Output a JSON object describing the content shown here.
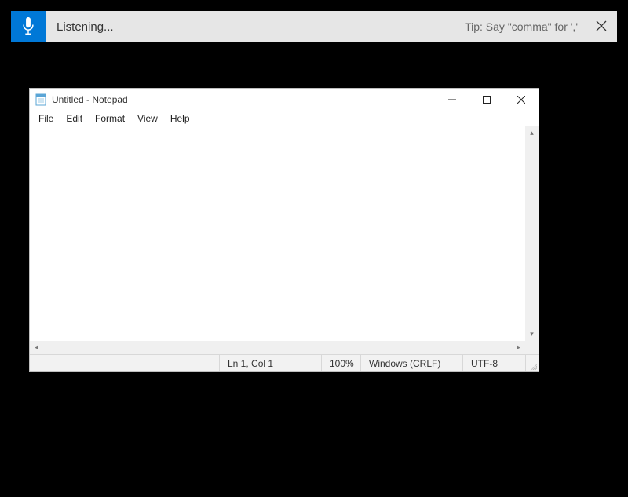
{
  "speech": {
    "status": "Listening...",
    "tip": "Tip: Say \"comma\" for ','"
  },
  "notepad": {
    "title": "Untitled - Notepad",
    "menu": {
      "file": "File",
      "edit": "Edit",
      "format": "Format",
      "view": "View",
      "help": "Help"
    },
    "editor_value": "",
    "status": {
      "position": "Ln 1, Col 1",
      "zoom": "100%",
      "line_ending": "Windows (CRLF)",
      "encoding": "UTF-8"
    }
  }
}
